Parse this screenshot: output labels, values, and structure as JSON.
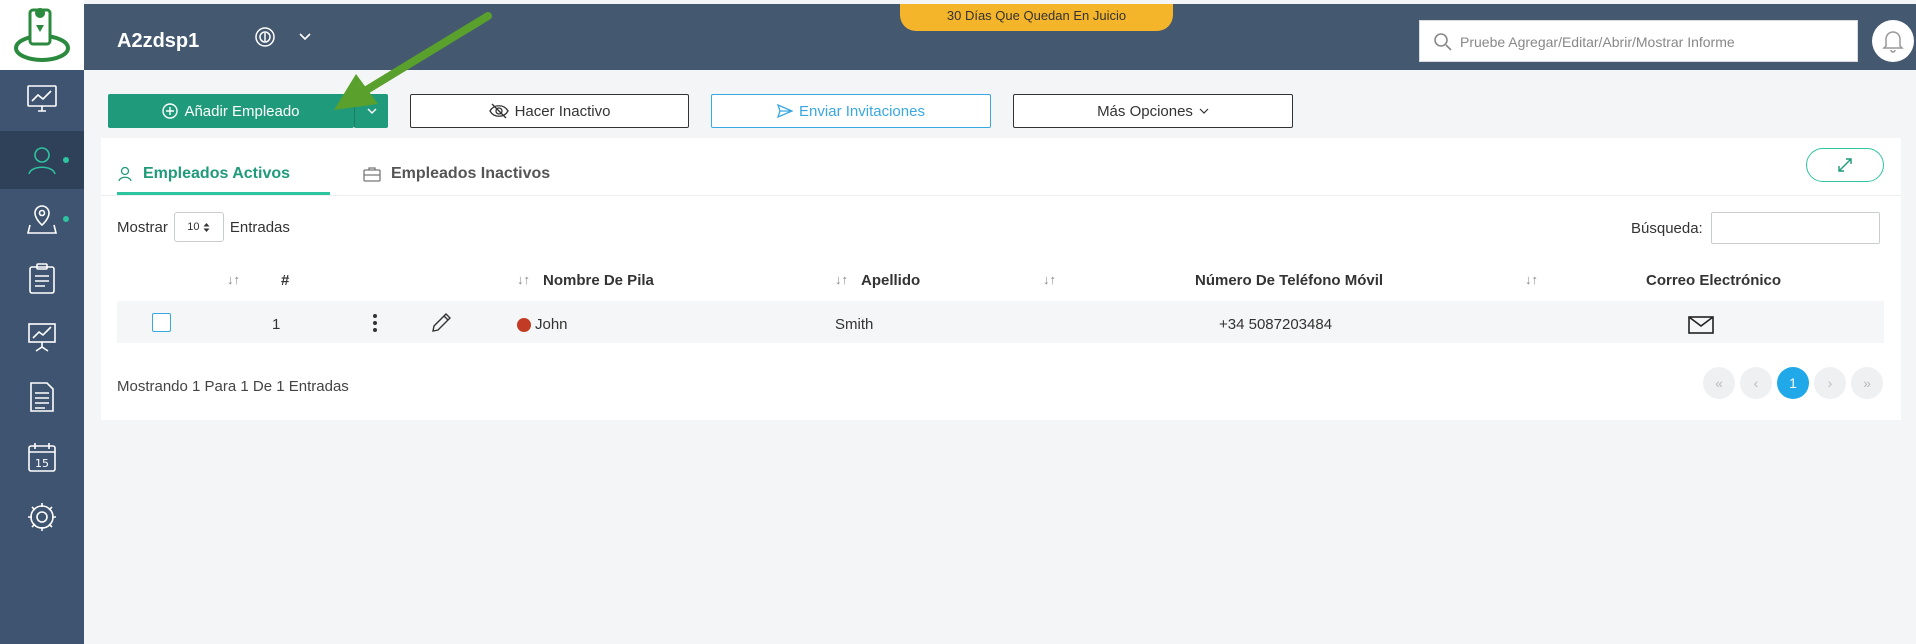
{
  "header": {
    "brand": "A2zdsp1",
    "trial_banner": "30 Días Que Quedan En Juicio",
    "search_placeholder": "Pruebe Agregar/Editar/Abrir/Mostrar Informe"
  },
  "sidebar": {
    "items": [
      {
        "name": "dashboard"
      },
      {
        "name": "employees",
        "active": true,
        "dot": true
      },
      {
        "name": "locations",
        "dot": true
      },
      {
        "name": "tasks"
      },
      {
        "name": "reports"
      },
      {
        "name": "documents"
      },
      {
        "name": "calendar",
        "number": "15"
      },
      {
        "name": "settings"
      }
    ]
  },
  "toolbar": {
    "add_label": "Añadir Empleado",
    "inactive_label": "Hacer Inactivo",
    "invite_label": "Enviar Invitaciones",
    "more_label": "Más Opciones"
  },
  "tabs": {
    "active_label": "Empleados Activos",
    "inactive_label": "Empleados Inactivos"
  },
  "list_controls": {
    "show_label": "Mostrar",
    "show_value": "10",
    "entries_label": "Entradas",
    "search_label": "Búsqueda:"
  },
  "table": {
    "headers": {
      "number": "#",
      "first_name": "Nombre De Pila",
      "last_name": "Apellido",
      "phone": "Número De Teléfono Móvil",
      "email": "Correo Electrónico"
    },
    "rows": [
      {
        "number": "1",
        "first_name": "John",
        "last_name": "Smith",
        "phone": "+34 5087203484",
        "status_color": "#c23b23"
      }
    ]
  },
  "footer": {
    "info": "Mostrando 1 Para 1 De 1 Entradas",
    "current_page": "1"
  },
  "colors": {
    "primary": "#1f9a7a",
    "accent": "#2ec4a0",
    "blue": "#20a8e8",
    "sidebar": "#3f5470",
    "header": "#44586f",
    "trial": "#f5b52a"
  }
}
